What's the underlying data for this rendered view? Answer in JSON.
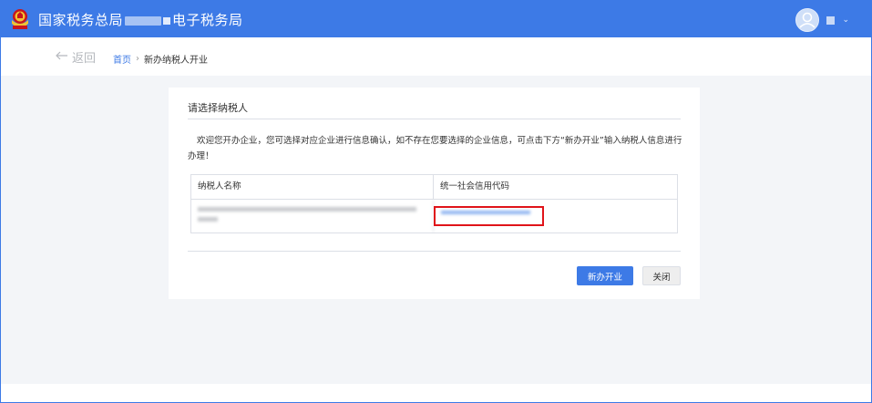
{
  "header": {
    "site_title_part1": "国家税务总局",
    "site_title_part2": "电子税务局",
    "logo": "tax-emblem-icon",
    "avatar": "user-avatar-icon",
    "caret": "chevron-down-icon",
    "accent_color": "#3d7ae6"
  },
  "breadcrumb": {
    "back_label": "返回",
    "home_label": "首页",
    "separator": "›",
    "current_label": "新办纳税人开业"
  },
  "dialog": {
    "title": "请选择纳税人",
    "message": "欢迎您开办企业，您可选择对应企业进行信息确认，如不存在您要选择的企业信息，可点击下方“新办开业”输入纳税人信息进行办理！",
    "table": {
      "headers": [
        "纳税人名称",
        "统一社会信用代码"
      ]
    },
    "buttons": {
      "new_business": "新办开业",
      "close": "关闭"
    },
    "highlight_color": "#e0141a"
  }
}
